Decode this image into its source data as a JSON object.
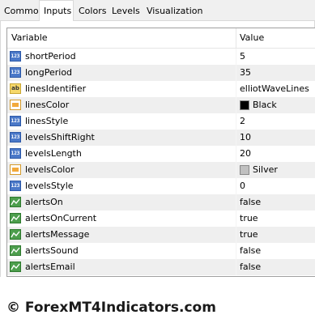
{
  "tabs": [
    "Common",
    "Inputs",
    "Colors",
    "Levels",
    "Visualization"
  ],
  "active_tab": "Inputs",
  "grid": {
    "col_variable": "Variable",
    "col_value": "Value"
  },
  "rows": [
    {
      "icon": "integer-icon",
      "name": "shortPeriod",
      "value": "5"
    },
    {
      "icon": "integer-icon",
      "name": "longPeriod",
      "value": "35"
    },
    {
      "icon": "string-icon",
      "name": "linesIdentifier",
      "value": "elliotWaveLines"
    },
    {
      "icon": "color-icon",
      "name": "linesColor",
      "value": "Black",
      "swatch": "#000000"
    },
    {
      "icon": "integer-icon",
      "name": "linesStyle",
      "value": "2"
    },
    {
      "icon": "integer-icon",
      "name": "levelsShiftRight",
      "value": "10"
    },
    {
      "icon": "integer-icon",
      "name": "levelsLength",
      "value": "20"
    },
    {
      "icon": "color-icon",
      "name": "levelsColor",
      "value": "Silver",
      "swatch": "#c0c0c0"
    },
    {
      "icon": "integer-icon",
      "name": "levelsStyle",
      "value": "0"
    },
    {
      "icon": "boolean-icon",
      "name": "alertsOn",
      "value": "false"
    },
    {
      "icon": "boolean-icon",
      "name": "alertsOnCurrent",
      "value": "true"
    },
    {
      "icon": "boolean-icon",
      "name": "alertsMessage",
      "value": "true"
    },
    {
      "icon": "boolean-icon",
      "name": "alertsSound",
      "value": "false"
    },
    {
      "icon": "boolean-icon",
      "name": "alertsEmail",
      "value": "false"
    }
  ],
  "icon_text": {
    "integer": "123",
    "string": "ab"
  },
  "watermark": "© ForexMT4Indicators.com"
}
